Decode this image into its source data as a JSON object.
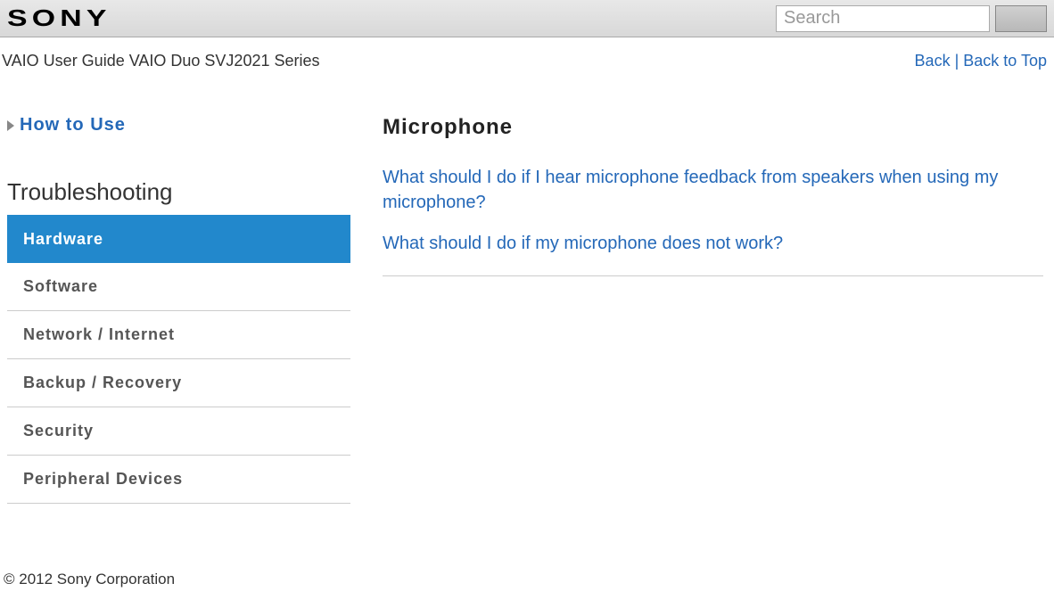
{
  "header": {
    "brand": "SONY",
    "search_placeholder": "Search"
  },
  "subheader": {
    "title": "VAIO User Guide VAIO Duo SVJ2021 Series",
    "back_label": "Back",
    "separator": " | ",
    "top_label": "Back to Top"
  },
  "sidebar": {
    "how_to_use": "How to Use",
    "section_title": "Troubleshooting",
    "items": [
      {
        "label": "Hardware",
        "active": true
      },
      {
        "label": "Software",
        "active": false
      },
      {
        "label": "Network / Internet",
        "active": false
      },
      {
        "label": "Backup / Recovery",
        "active": false
      },
      {
        "label": "Security",
        "active": false
      },
      {
        "label": "Peripheral Devices",
        "active": false
      }
    ]
  },
  "main": {
    "title": "Microphone",
    "questions": [
      "What should I do if I hear microphone feedback from speakers when using my microphone?",
      "What should I do if my microphone does not work?"
    ]
  },
  "footer": {
    "copyright": "© 2012 Sony Corporation"
  }
}
